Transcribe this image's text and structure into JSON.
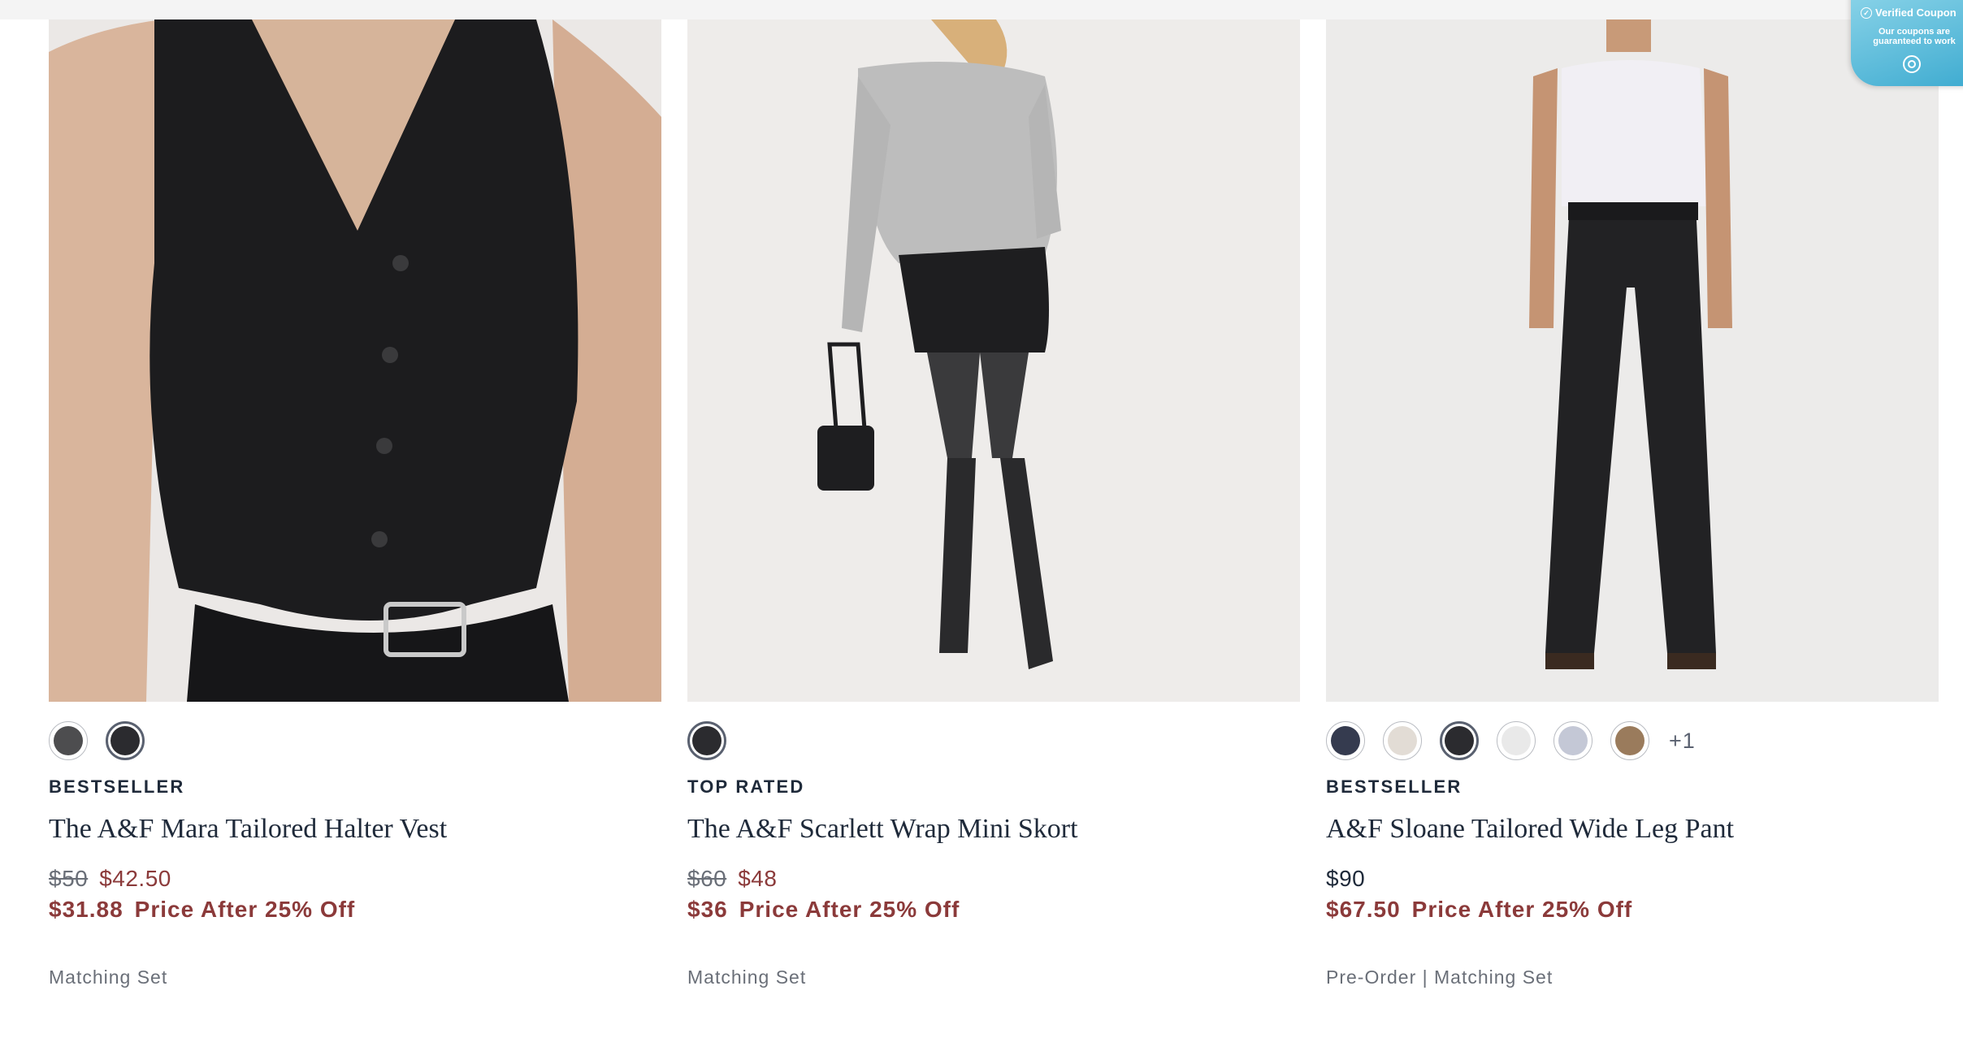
{
  "coupon": {
    "title": "Verified Coupon",
    "subtitle": "Our coupons are guaranteed to work",
    "accent": "#3aa9cf"
  },
  "products": [
    {
      "image_alt": "The A&F Mara Tailored Halter Vest",
      "swatches": [
        "#4d4d4f",
        "#2b2b2f"
      ],
      "selected_swatch": 1,
      "more": "",
      "badge": "BESTSELLER",
      "title": "The A&F Mara Tailored Halter Vest",
      "original_price": "$50",
      "price": "$42.50",
      "discount_price": "$31.88",
      "discount_label": "Price After 25% Off",
      "tags": "Matching Set"
    },
    {
      "image_alt": "The A&F Scarlett Wrap Mini Skort",
      "swatches": [
        "#2b2b2f"
      ],
      "selected_swatch": 0,
      "more": "",
      "badge": "TOP RATED",
      "title": "The A&F Scarlett Wrap Mini Skort",
      "original_price": "$60",
      "price": "$48",
      "discount_price": "$36",
      "discount_label": "Price After 25% Off",
      "tags": "Matching Set"
    },
    {
      "image_alt": "A&F Sloane Tailored Wide Leg Pant",
      "swatches": [
        "#353b4f",
        "#e2dcd5",
        "#2b2b2f",
        "#e9e9e9",
        "#c4c8d6",
        "#9a7b5c"
      ],
      "selected_swatch": 2,
      "more": "+1",
      "badge": "BESTSELLER",
      "title": "A&F Sloane Tailored Wide Leg Pant",
      "original_price": "",
      "price": "$90",
      "discount_price": "$67.50",
      "discount_label": "Price After 25% Off",
      "tags": "Pre-Order | Matching Set"
    }
  ],
  "colors": {
    "sale": "#8b3a3a",
    "text": "#1f2a3a",
    "muted": "#6a6f78"
  }
}
